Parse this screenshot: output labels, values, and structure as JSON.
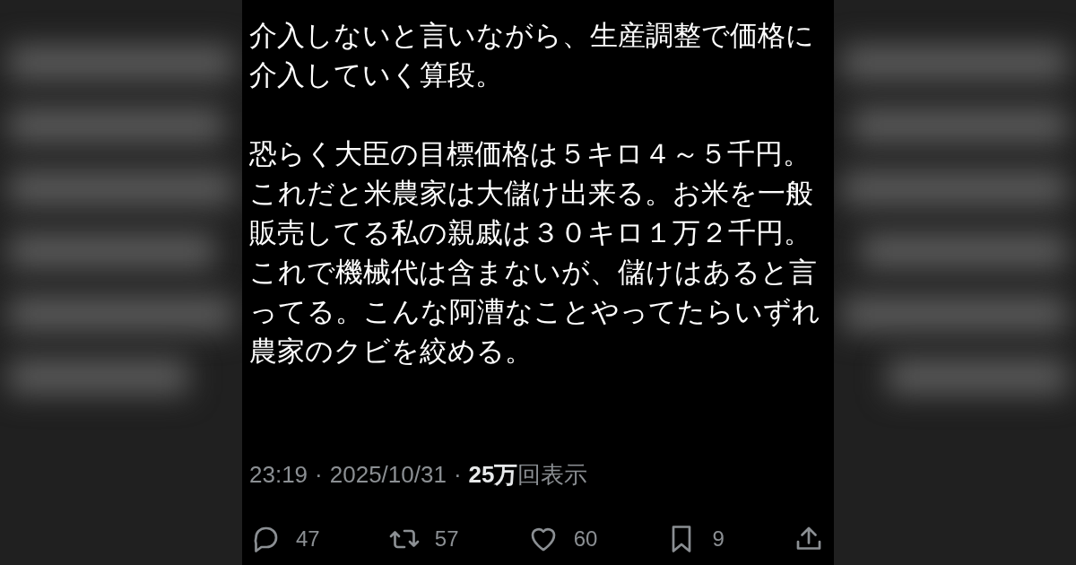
{
  "post": {
    "paragraphs": [
      {
        "lines": [
          "介入しないと言いながら、生産調整で価格に",
          "介入していく算段。"
        ]
      },
      {
        "lines": [
          "恐らく大臣の目標価格は５キロ４～５千円。",
          "これだと米農家は大儲け出来る。お米を一般",
          "販売してる私の親戚は３０キロ１万２千円。",
          "これで機械代は含まないが、儲けはあると言",
          "ってる。こんな阿漕なことやってたらいずれ",
          "農家のクビを絞める。"
        ]
      }
    ],
    "time": "23:19",
    "separator": "·",
    "date": "2025/10/31",
    "views_count": "25万",
    "views_label": "回表示",
    "actions": [
      {
        "kind": "reply",
        "count": "47"
      },
      {
        "kind": "repost",
        "count": "57"
      },
      {
        "kind": "like",
        "count": "60"
      },
      {
        "kind": "bookmark",
        "count": "9"
      },
      {
        "kind": "share"
      }
    ]
  }
}
